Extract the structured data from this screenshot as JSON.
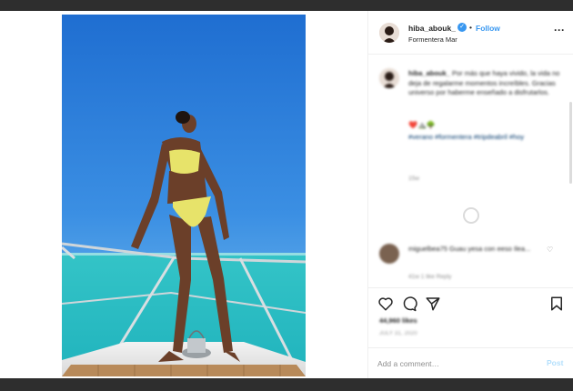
{
  "post": {
    "username": "hiba_abouk_",
    "verified_icon": "verified-badge-icon",
    "separator": "•",
    "follow_label": "Follow",
    "location": "Formentera Mar",
    "more_icon": "more-options-icon",
    "more_label": "···"
  },
  "caption": {
    "username": "hiba_abouk_",
    "text": "Por más que haya vivido, la vida no deja de regalarme momentos increíbles. Gracias universo por haberme enseñado a disfrutarlos.",
    "emojis": "❤️⛰️🌳",
    "hashtags": "#verano #formentera #tripdeabril #hoy",
    "time": "15w"
  },
  "comment": {
    "username": "miguelbea75",
    "text": "miguelbea75 Guau yesa con eeso Ilea...",
    "meta": "41w  1 like  Reply"
  },
  "actions": {
    "like_icon": "heart-icon",
    "comment_icon": "comment-icon",
    "share_icon": "share-icon",
    "save_icon": "bookmark-icon"
  },
  "likes": "44,960 likes",
  "date": "JULY 31, 2020",
  "add_comment": {
    "placeholder": "Add a comment…",
    "post_label": "Post"
  },
  "colors": {
    "accent": "#3897f0",
    "post_disabled": "#b2dffc",
    "sky": "#2a7fd6",
    "sea": "#2bc2c8"
  }
}
